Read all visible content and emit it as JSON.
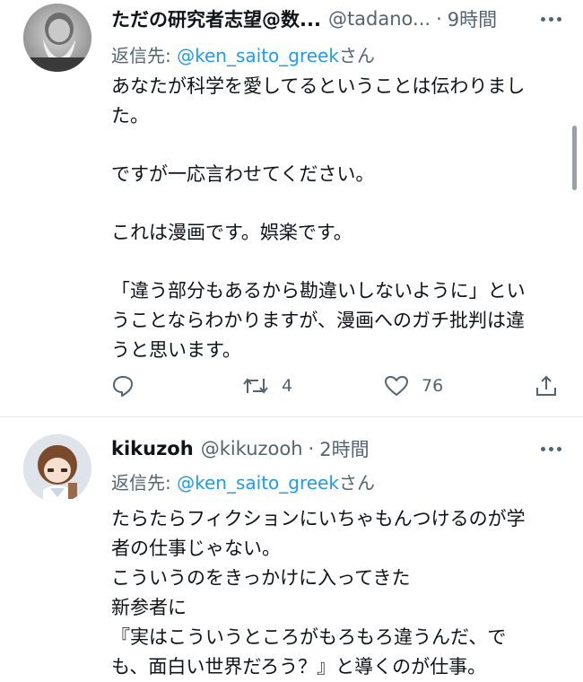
{
  "tweets": [
    {
      "name": "ただの研究者志望@数...",
      "handle": "@tadano...",
      "separator": "·",
      "time": "9時間",
      "reply_prefix": "返信先: ",
      "reply_mention": "@ken_saito_greek",
      "reply_suffix": "さん",
      "lines": [
        "あなたが科学を愛してるということは伝わりまし",
        "た。",
        "",
        "ですが一応言わせてください。",
        "",
        "これは漫画です。娯楽です。",
        "",
        "「違う部分もあるから勘違いしないように」とい",
        "うことならわかりますが、漫画へのガチ批判は違",
        "うと思います。"
      ],
      "retweets": "4",
      "likes": "76"
    },
    {
      "name": "kikuzoh",
      "handle": "@kikuzooh",
      "separator": "·",
      "time": "2時間",
      "reply_prefix": "返信先: ",
      "reply_mention": "@ken_saito_greek",
      "reply_suffix": "さん",
      "lines": [
        "たらたらフィクションにいちゃもんつけるのが学",
        "者の仕事じゃない。",
        "こういうのをきっかけに入ってきた",
        "新参者に",
        "『実はこういうところがもろもろ違うんだ、で",
        "も、面白い世界だろう？』と導くのが仕事。"
      ]
    }
  ],
  "colors": {
    "accent": "#1d9bf0",
    "secondary_text": "#536471",
    "primary_text": "#0f1419",
    "divider": "#e6e9ec"
  },
  "icons": [
    "more-icon",
    "reply-icon",
    "retweet-icon",
    "like-icon",
    "share-icon"
  ]
}
